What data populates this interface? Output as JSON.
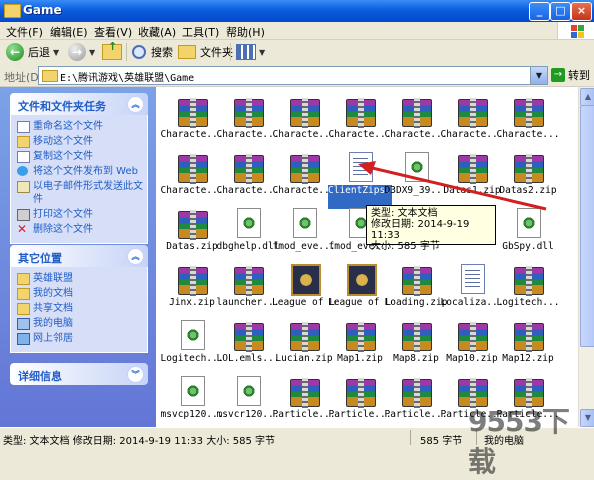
{
  "window": {
    "title": "Game",
    "minimize": "_",
    "maximize": "□",
    "close": "×"
  },
  "menu": [
    "文件(F)",
    "编辑(E)",
    "查看(V)",
    "收藏(A)",
    "工具(T)",
    "帮助(H)"
  ],
  "toolbar": {
    "back": "后退",
    "search": "搜索",
    "folders": "文件夹"
  },
  "address": {
    "label": "地址(D)",
    "path": "E:\\腾讯游戏\\英雄联盟\\Game",
    "go": "转到"
  },
  "tasks": {
    "file_tasks": {
      "title": "文件和文件夹任务",
      "items": [
        "重命名这个文件",
        "移动这个文件",
        "复制这个文件",
        "将这个文件发布到 Web",
        "以电子邮件形式发送此文件",
        "打印这个文件",
        "删除这个文件"
      ]
    },
    "other_places": {
      "title": "其它位置",
      "items": [
        "英雄联盟",
        "我的文档",
        "共享文档",
        "我的电脑",
        "网上邻居"
      ]
    },
    "details": {
      "title": "详细信息"
    }
  },
  "files": [
    [
      "Characte...",
      "Characte...",
      "Characte...",
      "Characte...",
      "Characte...",
      "Characte...",
      "Characte..."
    ],
    [
      "Characte...",
      "Characte...",
      "Characte...",
      "ClientZips.txt",
      "D3DX9_39...",
      "Datas1.zip",
      "Datas2.zip"
    ],
    [
      "Datas.zip",
      "dbghelp.dll",
      "fmod_eve...",
      "fmod_eve...",
      "",
      "",
      "GbSpy.dll"
    ],
    [
      "Jinx.zip",
      "launcher...",
      "League of Legends.exe",
      "League of LegendsB...",
      "Loading.zip",
      "Localiza...",
      "Logitech..."
    ],
    [
      "Logitech...",
      "LOL.emls...",
      "Lucian.zip",
      "Map1.zip",
      "Map8.zip",
      "Map10.zip",
      "Map12.zip"
    ],
    [
      "msvcp120...",
      "msvcr120...",
      "Particle...",
      "Particle...",
      "Particle...",
      "Particle...",
      "Particle..."
    ]
  ],
  "icon_types": [
    [
      "rar",
      "rar",
      "rar",
      "rar",
      "rar",
      "rar",
      "rar"
    ],
    [
      "rar",
      "rar",
      "rar",
      "txt",
      "dll",
      "rar",
      "rar"
    ],
    [
      "rar",
      "dll",
      "dll",
      "dll",
      "none",
      "none",
      "dll"
    ],
    [
      "rar",
      "rar",
      "lol",
      "lol",
      "rar",
      "txt",
      "rar"
    ],
    [
      "dll",
      "rar",
      "rar",
      "rar",
      "rar",
      "rar",
      "rar"
    ],
    [
      "dll",
      "dll",
      "rar",
      "rar",
      "rar",
      "rar",
      "rar"
    ]
  ],
  "tooltip": {
    "type": "类型: 文本文档",
    "modified": "修改日期: 2014-9-19 11:33",
    "size": "大小: 585 字节"
  },
  "status": {
    "info": "类型: 文本文档 修改日期: 2014-9-19 11:33 大小: 585 字节",
    "size": "585 字节",
    "location": "我的电脑"
  },
  "watermark": "9553下载",
  "colors": {
    "titlebar": "#0a5ee0",
    "taskpane": "#6d8ae0",
    "selection": "#316ac5",
    "arrow": "#d21f1f"
  }
}
